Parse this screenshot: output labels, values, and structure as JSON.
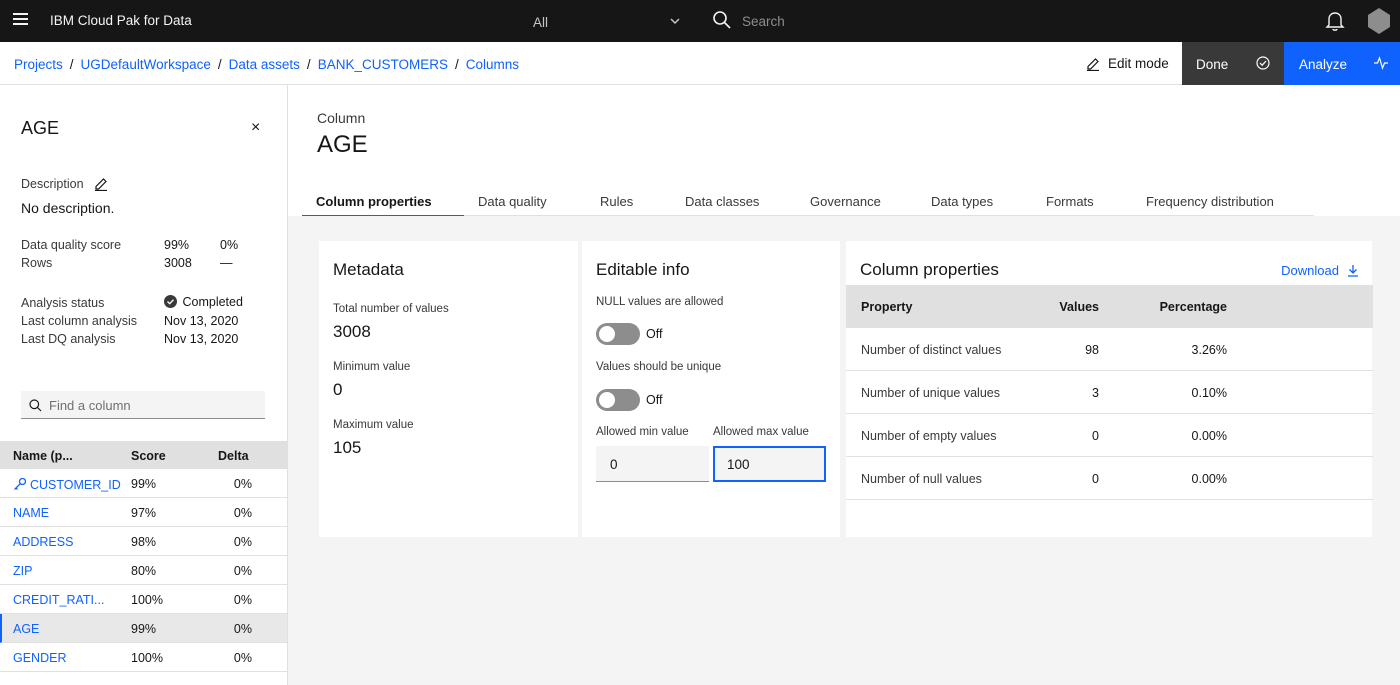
{
  "header": {
    "brand": "IBM Cloud Pak for Data",
    "scope": "All",
    "search_placeholder": "Search",
    "icons": [
      "menu-icon",
      "chevron-down-icon",
      "search-icon",
      "notification-icon",
      "user-avatar"
    ]
  },
  "breadcrumb": {
    "items": [
      "Projects",
      "UGDefaultWorkspace",
      "Data assets",
      "BANK_CUSTOMERS",
      "Columns"
    ],
    "separator": "/"
  },
  "actions": {
    "edit_mode": "Edit mode",
    "done": "Done",
    "analyze": "Analyze"
  },
  "sidebar": {
    "title": "AGE",
    "close": "×",
    "description_label": "Description",
    "description": "No description.",
    "dq_score_label": "Data quality score",
    "dq_score": "99%",
    "dq_delta": "0%",
    "rows_label": "Rows",
    "rows": "3008",
    "rows_delta": "—",
    "analysis_status_label": "Analysis status",
    "analysis_status": "Completed",
    "last_column_analysis_label": "Last column analysis",
    "last_column_analysis": "Nov 13, 2020",
    "last_dq_analysis_label": "Last DQ analysis",
    "last_dq_analysis": "Nov 13, 2020",
    "find_placeholder": "Find a column",
    "table": {
      "headers": [
        "Name (p...",
        "Score",
        "Delta"
      ],
      "rows": [
        {
          "name": "CUSTOMER_ID",
          "score": "99%",
          "delta": "0%"
        },
        {
          "name": "NAME",
          "score": "97%",
          "delta": "0%"
        },
        {
          "name": "ADDRESS",
          "score": "98%",
          "delta": "0%"
        },
        {
          "name": "ZIP",
          "score": "80%",
          "delta": "0%"
        },
        {
          "name": "CREDIT_RATI...",
          "score": "100%",
          "delta": "0%"
        },
        {
          "name": "AGE",
          "score": "99%",
          "delta": "0%"
        },
        {
          "name": "GENDER",
          "score": "100%",
          "delta": "0%"
        }
      ]
    }
  },
  "main": {
    "label": "Column",
    "title": "AGE",
    "tabs": [
      "Column properties",
      "Data quality",
      "Rules",
      "Data classes",
      "Governance",
      "Data types",
      "Formats",
      "Frequency distribution"
    ],
    "metadata": {
      "title": "Metadata",
      "total_label": "Total number of values",
      "total": "3008",
      "min_label": "Minimum value",
      "min": "0",
      "max_label": "Maximum value",
      "max": "105"
    },
    "editable": {
      "title": "Editable info",
      "null_label": "NULL values are allowed",
      "null_state": "Off",
      "unique_label": "Values should be unique",
      "unique_state": "Off",
      "min_label": "Allowed min value",
      "min_value": "0",
      "max_label": "Allowed max value",
      "max_value": "100"
    },
    "properties": {
      "title": "Column properties",
      "download": "Download",
      "headers": [
        "Property",
        "Values",
        "Percentage"
      ],
      "rows": [
        {
          "property": "Number of distinct values",
          "value": "98",
          "percentage": "3.26%"
        },
        {
          "property": "Number of unique values",
          "value": "3",
          "percentage": "0.10%"
        },
        {
          "property": "Number of empty values",
          "value": "0",
          "percentage": "0.00%"
        },
        {
          "property": "Number of null values",
          "value": "0",
          "percentage": "0.00%"
        }
      ]
    }
  },
  "colors": {
    "header_bg": "#161616",
    "link": "#0f62fe",
    "done_bg": "#393939",
    "analyze_bg": "#0f62fe",
    "panel_bg": "#f4f4f4"
  }
}
